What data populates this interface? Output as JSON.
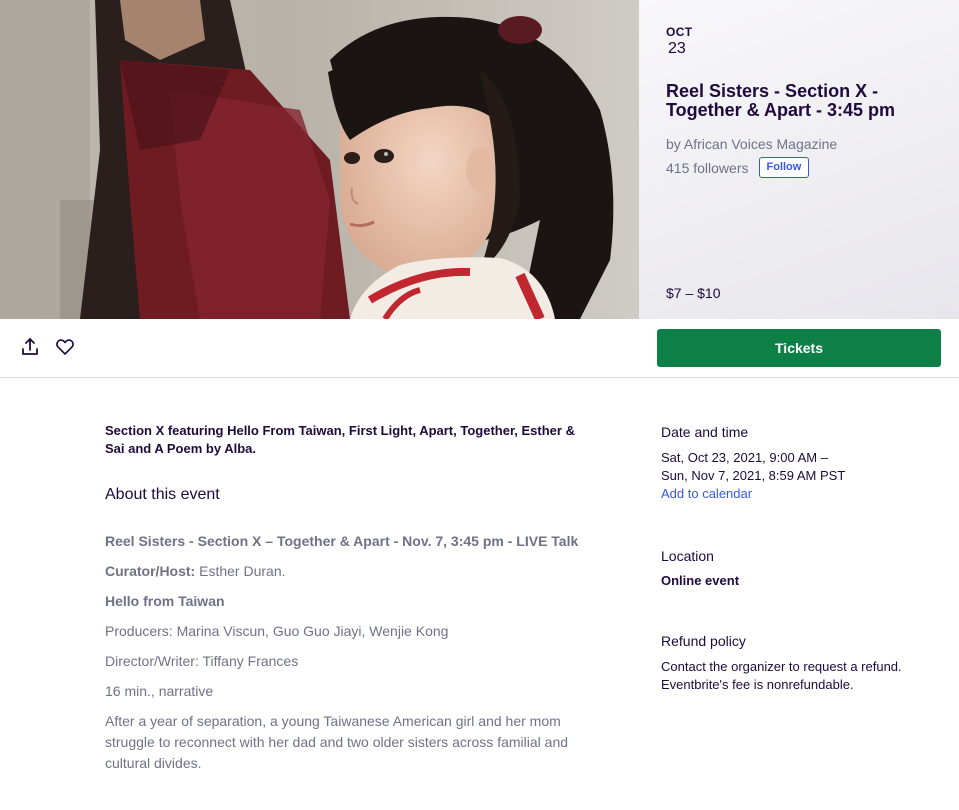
{
  "hero": {
    "image_alt": "Young girl with bangs seated next to a woman in a dark red knit top",
    "date": {
      "month": "OCT",
      "day": "23"
    },
    "title": "Reel Sisters - Section X - Together & Apart - 3:45 pm",
    "organizer": "by African Voices Magazine",
    "followers": "415 followers",
    "follow_label": "Follow",
    "price": "$7 – $10"
  },
  "actions": {
    "share_icon": "share-icon",
    "like_icon": "heart-icon",
    "tickets_label": "Tickets"
  },
  "main": {
    "summary": "Section X featuring Hello From Taiwan, First Light, Apart, Together, Esther & Sai and A Poem by Alba.",
    "about_heading": "About this event",
    "event_heading": "Reel Sisters - Section X – Together & Apart - Nov. 7, 3:45 pm - LIVE Talk",
    "curator_label": "Curator/Host:",
    "curator_value": " Esther Duran.",
    "film_title": "Hello from Taiwan",
    "producers": "Producers: Marina Viscun, Guo Guo Jiayi, Wenjie Kong",
    "director": "Director/Writer: Tiffany Frances",
    "runtime": "16 min., narrative",
    "synopsis": "After a year of separation, a young Taiwanese American girl and her mom struggle to reconnect with her dad and two older sisters across familial and cultural divides."
  },
  "sidebar": {
    "date_heading": "Date and time",
    "date_line1": "Sat, Oct 23, 2021, 9:00 AM –",
    "date_line2": "Sun, Nov 7, 2021, 8:59 AM PST",
    "add_calendar": "Add to calendar",
    "location_heading": "Location",
    "location_value": "Online event",
    "refund_heading": "Refund policy",
    "refund_line1": "Contact the organizer to request a refund.",
    "refund_line2": "Eventbrite's fee is nonrefundable."
  },
  "colors": {
    "primary_text": "#1e0a3c",
    "secondary_text": "#6f7287",
    "link": "#3659e3",
    "tickets_button": "#0d8048"
  }
}
